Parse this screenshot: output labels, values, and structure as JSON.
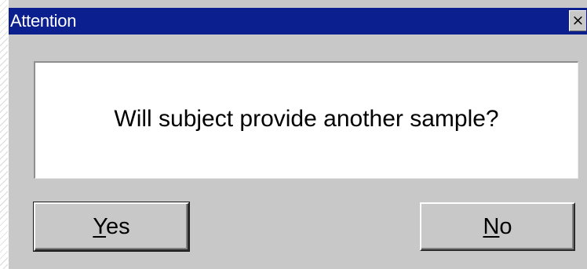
{
  "window": {
    "title": "Attention",
    "close_glyph": "×"
  },
  "message": {
    "text": "Will subject provide another sample?"
  },
  "buttons": {
    "yes": {
      "mnemonic": "Y",
      "rest": "es",
      "default": true
    },
    "no": {
      "mnemonic": "N",
      "rest": "o",
      "default": false
    }
  },
  "colors": {
    "title_bar": "#0b1f8f",
    "dialog_face": "#c8c8c8",
    "message_background": "#ffffff"
  },
  "icons": {
    "close": "close-icon"
  }
}
